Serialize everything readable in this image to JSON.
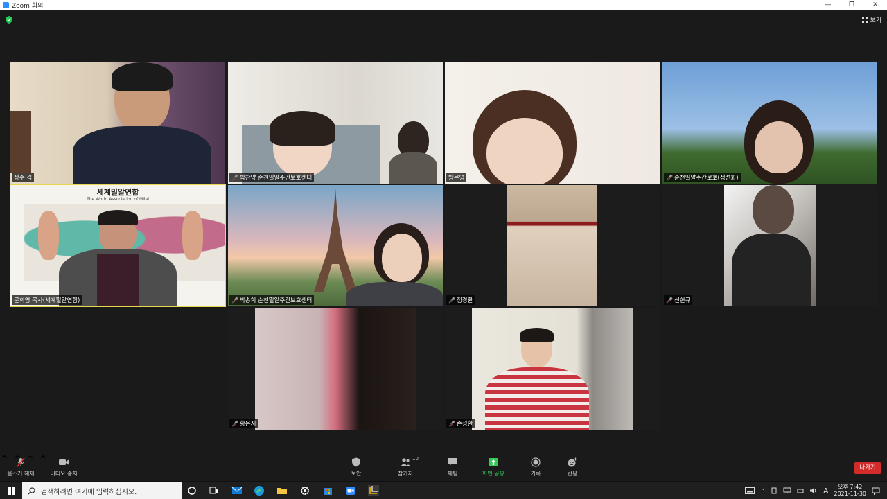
{
  "window": {
    "title": "Zoom 회의",
    "minimize": "—",
    "restore": "❐",
    "close": "✕"
  },
  "header": {
    "view_label": "보기"
  },
  "tiles": [
    {
      "name": "상수 김",
      "muted": false
    },
    {
      "name": "박찬양 순천밀알주간보호센터",
      "muted": true
    },
    {
      "name": "방은영",
      "muted": false
    },
    {
      "name": "순천밀알주간보호(정선화)",
      "muted": true
    },
    {
      "name": "문희영 목사(세계밀알연합)",
      "muted": false
    },
    {
      "name": "박송희 순천밀알주간보호센터",
      "muted": true
    },
    {
      "name": "정경환",
      "muted": true
    },
    {
      "name": "신현규",
      "muted": true
    },
    {
      "name": "황은지",
      "muted": true
    },
    {
      "name": "손성환",
      "muted": true
    }
  ],
  "slide": {
    "title": "세계밀알연합",
    "subtitle": "The World Association of Milal"
  },
  "toolbar": {
    "unmute": "음소거 해제",
    "stop_video": "비디오 중지",
    "security": "보안",
    "participants": "참가자",
    "participants_count": "10",
    "chat": "채팅",
    "share": "화면 공유",
    "record": "기록",
    "reactions": "반응",
    "leave": "나가기"
  },
  "taskbar": {
    "search_placeholder": "검색하려면 여기에 입력하십시오.",
    "time": "오후 7:42",
    "date": "2021-11-30",
    "ime": "A"
  },
  "colors": {
    "accent": "#2d8cff",
    "leave": "#d32a2a",
    "share": "#35c758",
    "active_speaker": "#e5d84a"
  }
}
